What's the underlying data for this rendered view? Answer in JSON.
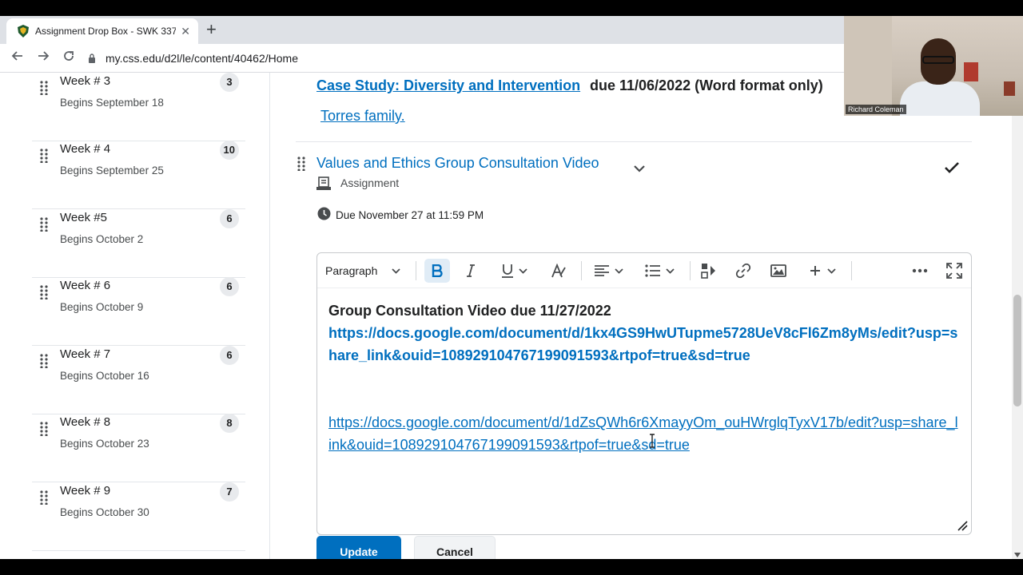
{
  "browser": {
    "tab_title": "Assignment Drop Box - SWK 337",
    "tab_close": "✕",
    "new_tab": "+",
    "url": "my.css.edu/d2l/le/content/40462/Home"
  },
  "sidebar": {
    "weeks": [
      {
        "title": "Week # 3",
        "subtitle": "Begins September 18",
        "count": "3"
      },
      {
        "title": "Week # 4",
        "subtitle": "Begins September 25",
        "count": "10"
      },
      {
        "title": "Week #5",
        "subtitle": "Begins October 2",
        "count": "6"
      },
      {
        "title": "Week # 6",
        "subtitle": "Begins October 9",
        "count": "6"
      },
      {
        "title": "Week # 7",
        "subtitle": "Begins October 16",
        "count": "6"
      },
      {
        "title": "Week # 8",
        "subtitle": "Begins October 23",
        "count": "8"
      },
      {
        "title": "Week # 9",
        "subtitle": "Begins October 30",
        "count": "7"
      }
    ]
  },
  "main": {
    "case_study_link": "Case Study: Diversity and Intervention",
    "case_study_due": "due 11/06/2022 (Word format only)",
    "torres_link": "Torres family.",
    "item_title": "Values and Ethics Group Consultation Video",
    "item_type": "Assignment",
    "due": "Due November 27 at 11:59 PM"
  },
  "editor": {
    "format_label": "Paragraph",
    "heading": "Group Consultation Video due 11/27/2022",
    "link1": "https://docs.google.com/document/d/1kx4GS9HwUTupme5728UeV8cFl6Zm8yMs/edit?usp=share_link&ouid=108929104767199091593&rtpof=true&sd=true",
    "link2": "https://docs.google.com/document/d/1dZsQWh6r6XmayyOm_ouHWrglqTyxV17b/edit?usp=share_link&ouid=108929104767199091593&rtpof=true&sd=true"
  },
  "buttons": {
    "update": "Update",
    "cancel": "Cancel"
  },
  "webcam": {
    "participant_name": "Richard Coleman"
  },
  "colors": {
    "link": "#006fbf",
    "primary_button": "#006fbf",
    "bold_active_bg": "#e0ecf6"
  }
}
